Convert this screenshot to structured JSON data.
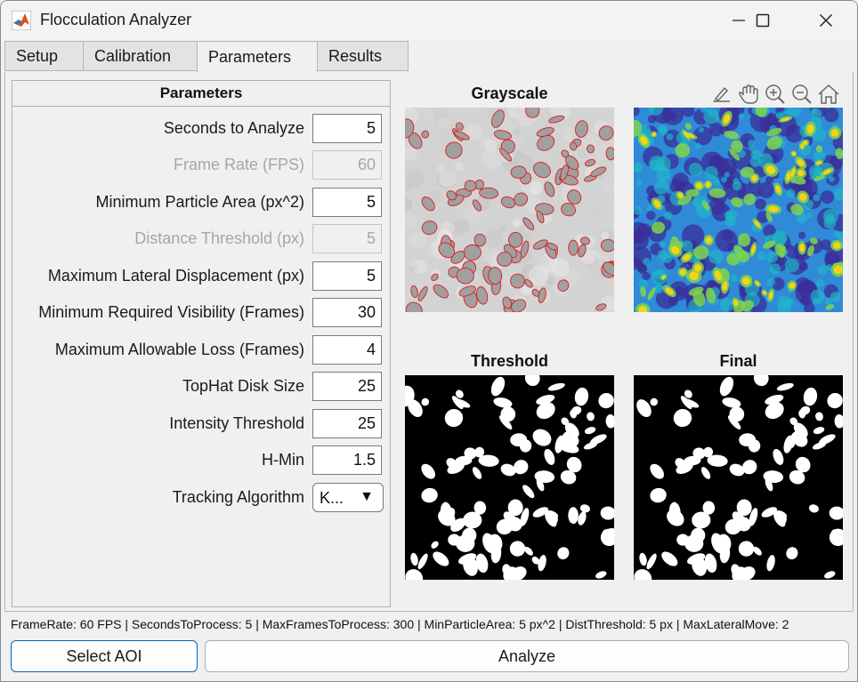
{
  "window": {
    "title": "Flocculation Analyzer"
  },
  "tabs": [
    {
      "label": "Setup"
    },
    {
      "label": "Calibration"
    },
    {
      "label": "Parameters"
    },
    {
      "label": "Results"
    }
  ],
  "panel": {
    "title": "Parameters",
    "rows": [
      {
        "label": "Seconds to Analyze",
        "value": "5",
        "enabled": true
      },
      {
        "label": "Frame Rate (FPS)",
        "value": "60",
        "enabled": false
      },
      {
        "label": "Minimum Particle Area (px^2)",
        "value": "5",
        "enabled": true
      },
      {
        "label": "Distance Threshold (px)",
        "value": "5",
        "enabled": false
      },
      {
        "label": "Maximum Lateral Displacement (px)",
        "value": "5",
        "enabled": true
      },
      {
        "label": "Minimum Required Visibility (Frames)",
        "value": "30",
        "enabled": true
      },
      {
        "label": "Maximum Allowable Loss (Frames)",
        "value": "4",
        "enabled": true
      },
      {
        "label": "TopHat Disk Size",
        "value": "25",
        "enabled": true
      },
      {
        "label": "Intensity Threshold",
        "value": "25",
        "enabled": true
      },
      {
        "label": "H-Min",
        "value": "1.5",
        "enabled": true
      }
    ],
    "tracking": {
      "label": "Tracking Algorithm",
      "value": "K...",
      "arrow": "▼"
    }
  },
  "axes": {
    "grayscale": {
      "title": "Grayscale"
    },
    "heatmap": {
      "title": ""
    },
    "threshold": {
      "title": "Threshold"
    },
    "final": {
      "title": "Final"
    }
  },
  "toolbar": {
    "icons": [
      "brush-icon",
      "pan-hand-icon",
      "zoom-in-icon",
      "zoom-out-icon",
      "home-icon"
    ]
  },
  "status": "FrameRate: 60 FPS | SecondsToProcess: 5 | MaxFramesToProcess: 300 | MinParticleArea: 5 px^2 | DistThreshold: 5 px | MaxLateralMove: 2",
  "buttons": {
    "select_aoi": "Select AOI",
    "analyze": "Analyze"
  },
  "colors": {
    "accent": "#0067c0",
    "outline": "#e01a1a",
    "heat_low": "#3b2d9a",
    "heat_mid": "#2f8ad8",
    "heat_high": "#f5d31b"
  }
}
